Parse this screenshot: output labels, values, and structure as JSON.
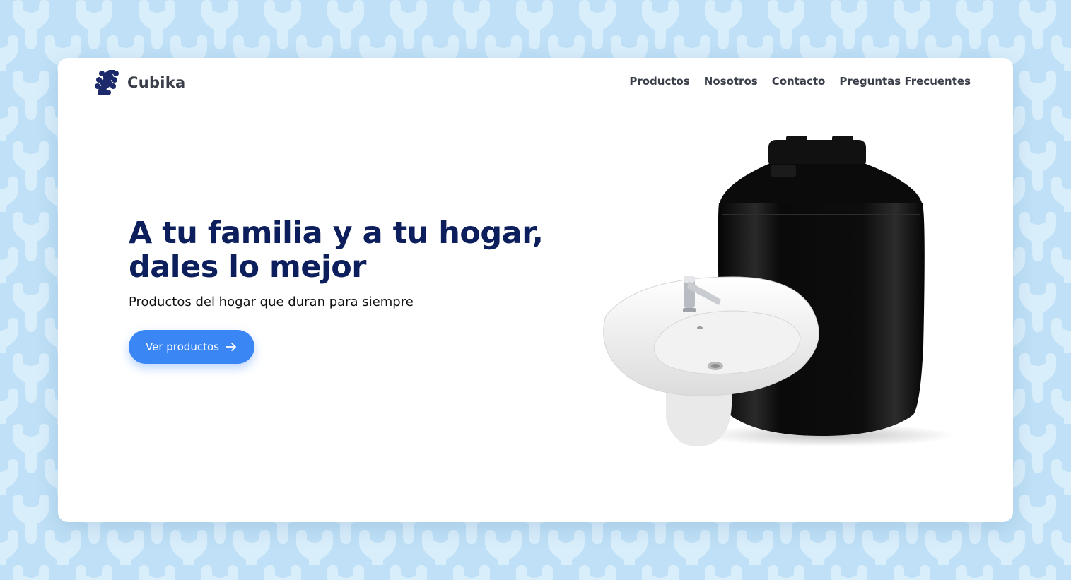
{
  "brand": {
    "name": "Cubika",
    "logo_icon": "cubika-logo-icon",
    "logo_color": "#1c2a6b"
  },
  "nav": {
    "items": [
      {
        "label": "Productos"
      },
      {
        "label": "Nosotros"
      },
      {
        "label": "Contacto"
      },
      {
        "label": "Preguntas Frecuentes"
      }
    ]
  },
  "hero": {
    "title_line1": "A tu familia y a tu hogar,",
    "title_line2": "dales lo mejor",
    "subtitle": "Productos del hogar que duran para siempre",
    "cta_label": "Ver productos",
    "cta_icon": "arrow-right-icon"
  },
  "colors": {
    "background": "#bfe0f6",
    "pattern": "#d9eefb",
    "title": "#0c1f5c",
    "accent": "#3b86f5",
    "text": "#3a3f4a"
  },
  "images": {
    "products": "water-tank-and-sink-image"
  }
}
